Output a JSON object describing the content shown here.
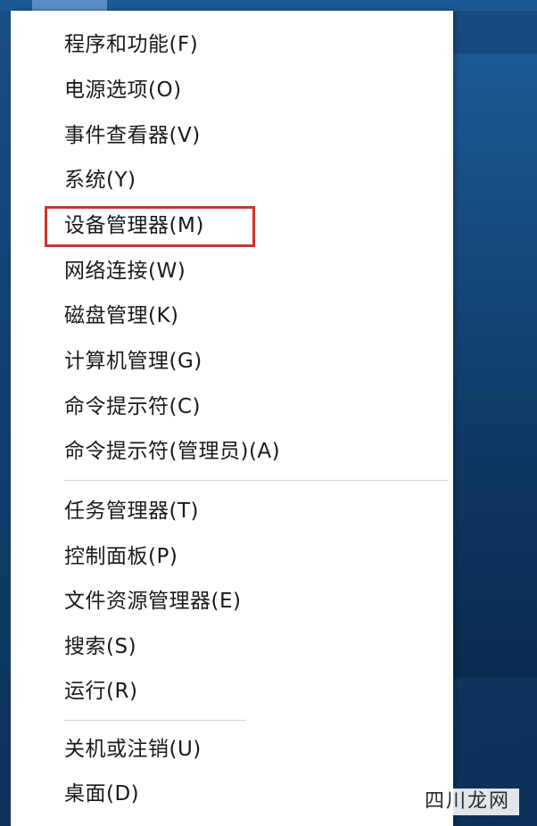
{
  "menu": {
    "items": [
      {
        "label": "程序和功能(F)"
      },
      {
        "label": "电源选项(O)"
      },
      {
        "label": "事件查看器(V)"
      },
      {
        "label": "系统(Y)"
      },
      {
        "label": "设备管理器(M)"
      },
      {
        "label": "网络连接(W)"
      },
      {
        "label": "磁盘管理(K)"
      },
      {
        "label": "计算机管理(G)"
      },
      {
        "label": "命令提示符(C)"
      },
      {
        "label": "命令提示符(管理员)(A)"
      },
      {
        "label": "任务管理器(T)"
      },
      {
        "label": "控制面板(P)"
      },
      {
        "label": "文件资源管理器(E)"
      },
      {
        "label": "搜索(S)"
      },
      {
        "label": "运行(R)"
      },
      {
        "label": "关机或注销(U)"
      },
      {
        "label": "桌面(D)"
      }
    ],
    "highlighted_item": "设备管理器(M)",
    "highlight_color": "#d23232"
  },
  "watermark": {
    "text": "四川龙网"
  }
}
